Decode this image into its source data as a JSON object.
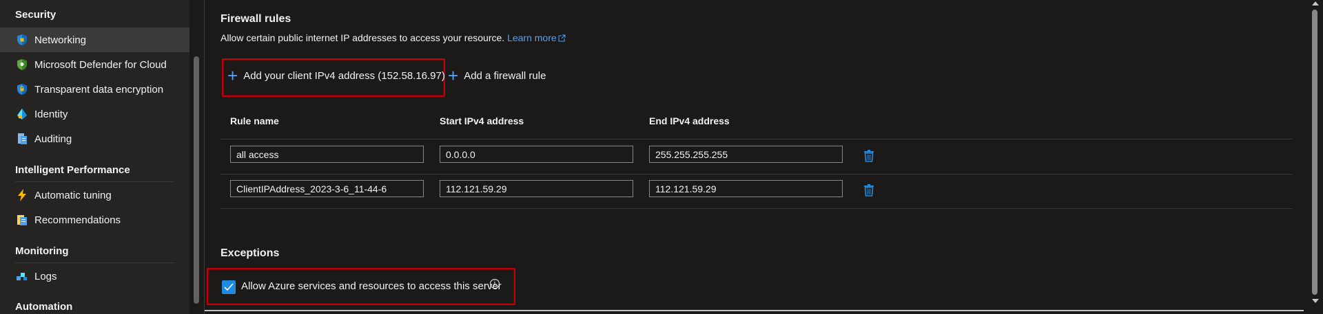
{
  "sidebar": {
    "sections": [
      {
        "title": "Security"
      },
      {
        "title": "Intelligent Performance"
      },
      {
        "title": "Monitoring"
      },
      {
        "title": "Automation"
      }
    ],
    "items": [
      {
        "label": "Networking",
        "icon": "networking-shield-icon"
      },
      {
        "label": "Microsoft Defender for Cloud",
        "icon": "defender-shield-icon"
      },
      {
        "label": "Transparent data encryption",
        "icon": "encryption-shield-icon"
      },
      {
        "label": "Identity",
        "icon": "identity-icon"
      },
      {
        "label": "Auditing",
        "icon": "auditing-icon"
      },
      {
        "label": "Automatic tuning",
        "icon": "lightning-icon"
      },
      {
        "label": "Recommendations",
        "icon": "recommendations-icon"
      },
      {
        "label": "Logs",
        "icon": "logs-icon"
      }
    ]
  },
  "firewall": {
    "title": "Firewall rules",
    "description": "Allow certain public internet IP addresses to access your resource.",
    "learn_more": "Learn more",
    "add_client_label": "Add your client IPv4 address (152.58.16.97)",
    "add_rule_label": "Add a firewall rule",
    "columns": [
      "Rule name",
      "Start IPv4 address",
      "End IPv4 address"
    ],
    "rules": [
      {
        "name": "all access",
        "start": "0.0.0.0",
        "end": "255.255.255.255"
      },
      {
        "name": "ClientIPAddress_2023-3-6_11-44-6",
        "start": "112.121.59.29",
        "end": "112.121.59.29"
      }
    ]
  },
  "exceptions": {
    "title": "Exceptions",
    "allow_azure_label": "Allow Azure services and resources to access this server",
    "allow_azure_checked": true
  },
  "colors": {
    "accent": "#4da3ff",
    "highlight": "#c4000b",
    "checkbox": "#1f8ae0"
  }
}
